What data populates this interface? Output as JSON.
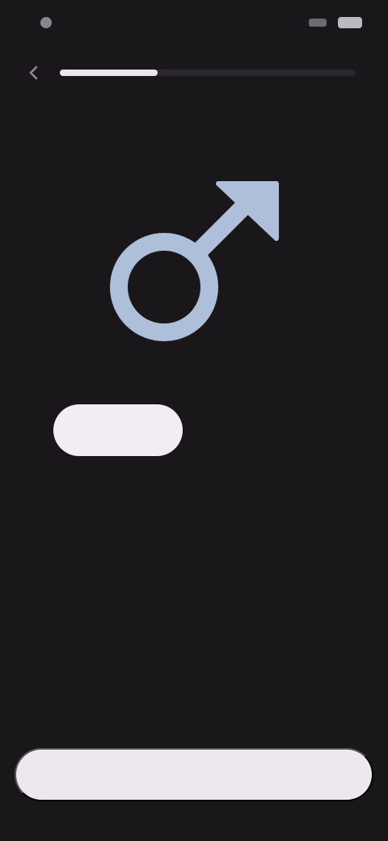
{
  "status_bar": {
    "time": "",
    "icons": [
      "notification-dot-icon",
      "signal-icon",
      "battery-icon"
    ]
  },
  "header": {
    "back_icon": "back-arrow-icon",
    "progress": 0.33
  },
  "question": {
    "text": ""
  },
  "symbol": {
    "icon": "male-symbol-icon",
    "color": "#aebfd9"
  },
  "options": [
    {
      "label": "",
      "selected": true
    },
    {
      "label": "",
      "selected": false
    }
  ],
  "cta": {
    "label": ""
  },
  "colors": {
    "background": "#1a171b",
    "accent": "#aebfd9",
    "button": "#ece8ee"
  }
}
